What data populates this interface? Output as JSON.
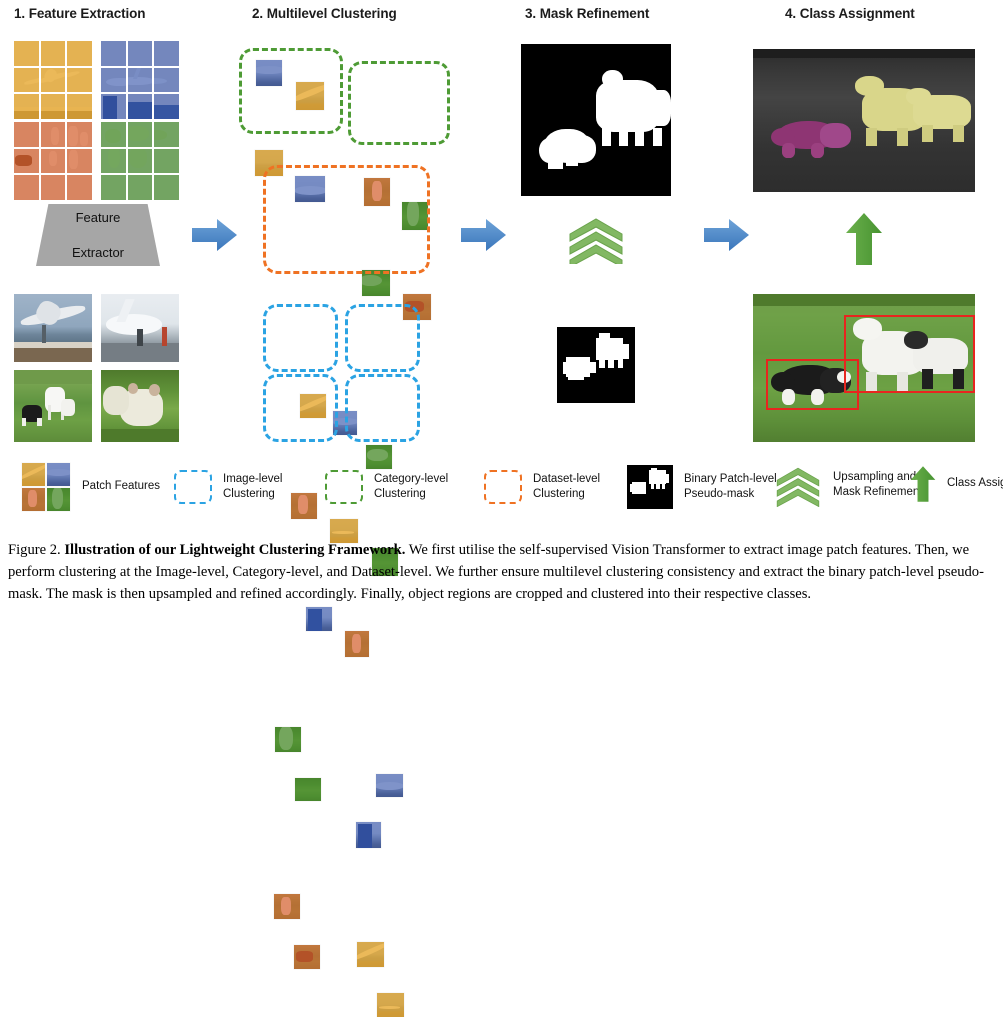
{
  "figure": {
    "number": "Figure 2.",
    "bold_title": "Illustration of our Lightweight Clustering Framework.",
    "caption_body": " We first utilise the self-supervised Vision Transformer to extract image patch features. Then, we perform clustering at the Image-level, Category-level, and Dataset-level. We further ensure multilevel clustering consistency and extract the binary patch-level pseudo-mask. The mask is then upsampled and refined accordingly. Finally, object regions are cropped and clustered into their respective classes."
  },
  "columns": [
    {
      "id": "feature-extraction",
      "label": "1. Feature Extraction"
    },
    {
      "id": "multilevel-clustering",
      "label": "2. Multilevel Clustering"
    },
    {
      "id": "mask-refinement",
      "label": "3. Mask Refinement"
    },
    {
      "id": "class-assignment",
      "label": "4. Class Assignment"
    }
  ],
  "feature_extractor": {
    "line1": "Feature",
    "line2": "Extractor"
  },
  "source_images": [
    {
      "id": "airplane-takeoff",
      "tint": "yellow"
    },
    {
      "id": "airplane-tarmac",
      "tint": "blue"
    },
    {
      "id": "dog-and-sheep-field",
      "tint": "orange"
    },
    {
      "id": "lambs-in-grass",
      "tint": "green"
    }
  ],
  "clustering": {
    "category_level": {
      "color": "#4e9b35",
      "groups": [
        {
          "id": "category-group-airplane",
          "patches": [
            "blue",
            "yellow",
            "yellow",
            "blue"
          ]
        },
        {
          "id": "category-group-animal",
          "patches": [
            "orange",
            "green",
            "green",
            "orange"
          ]
        }
      ]
    },
    "dataset_level": {
      "color": "#ef7223",
      "groups": [
        {
          "id": "dataset-group-all",
          "patches": [
            "yellow",
            "blue",
            "green",
            "orange",
            "yellow",
            "green",
            "blue",
            "orange"
          ]
        }
      ]
    },
    "image_level": {
      "color": "#2ba3e3",
      "groups": [
        {
          "id": "image-group-1",
          "patches": [
            "green",
            "green"
          ]
        },
        {
          "id": "image-group-2",
          "patches": [
            "blue",
            "blue"
          ]
        },
        {
          "id": "image-group-3",
          "patches": [
            "orange",
            "orange"
          ]
        },
        {
          "id": "image-group-4",
          "patches": [
            "yellow",
            "yellow"
          ]
        }
      ]
    }
  },
  "mask_refinement": {
    "refined_mask_id": "refined-binary-mask",
    "pseudo_mask_id": "patch-level-pseudo-mask",
    "upsample_icon": "triple-chevron-up-icon",
    "upsample_color": "#7fb661"
  },
  "class_assignment": {
    "segmented_image_id": "class-segmented-image",
    "detected_image_id": "cropped-object-regions-image",
    "arrow_icon": "up-arrow-icon",
    "arrow_color": "#56a13a",
    "bbox_color": "#e8251f",
    "mask_colors": {
      "dog": "#8e3573",
      "sheep": "#d9d68a"
    }
  },
  "arrows": {
    "color": "#4a86c8",
    "icon": "right-arrow-icon",
    "count": 3
  },
  "legend": [
    {
      "id": "patch-features",
      "icon": "patch-swatch-grid",
      "label": "Patch Features"
    },
    {
      "id": "image-level-clustering",
      "icon": "dashed-box-blue",
      "label": "Image-level\nClustering",
      "color": "#2ba3e3"
    },
    {
      "id": "category-level-clustering",
      "icon": "dashed-box-green",
      "label": "Category-level\nClustering",
      "color": "#4e9b35"
    },
    {
      "id": "dataset-level-clustering",
      "icon": "dashed-box-orange",
      "label": "Dataset-level\nClustering",
      "color": "#ef7223"
    },
    {
      "id": "binary-pseudo-mask",
      "icon": "binary-mask-thumb",
      "label": "Binary Patch-level\nPseudo-mask"
    },
    {
      "id": "upsampling-mask-refinement",
      "icon": "triple-chevron-up-icon",
      "label": "Upsampling and\nMask Refinement",
      "color": "#7fb661"
    },
    {
      "id": "class-assignment-legend",
      "icon": "up-arrow-icon",
      "label": "Class Assignment",
      "color": "#56a13a"
    }
  ]
}
